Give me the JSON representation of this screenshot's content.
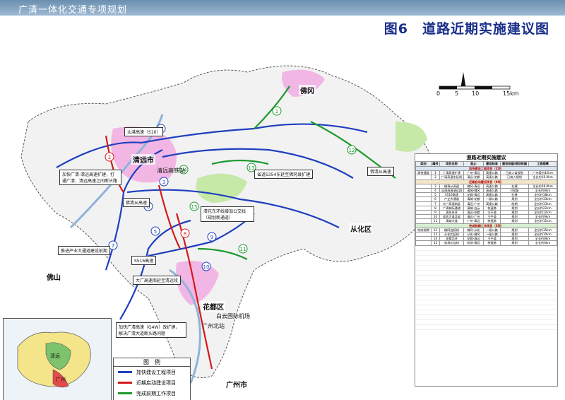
{
  "header": {
    "doc_title": "广清一体化交通专项规划",
    "figure_title": "图6　道路近期实施建议图"
  },
  "scale_bar": {
    "ticks": [
      "0",
      "5",
      "10",
      "15km"
    ],
    "north_letter": "N"
  },
  "places": {
    "qingyuan": "清远市",
    "fogang": "佛冈",
    "conghua": "从化区",
    "foshan": "佛山",
    "huadu": "花都区",
    "guangzhou": "广州市",
    "qingcheng_hub": "清远高铁站",
    "huadu_airport": "白云国际机场",
    "guangzhou_north": "广州北站"
  },
  "road_labels": {
    "shanqing": "汕湛高速（S16）",
    "s516": "S516高速",
    "yinglong": "佛清从高速"
  },
  "callouts": [
    "加快广清-清远高速扩建，打通广清、清远高速之间断头路",
    "省道S354东延至佛冈县扩建",
    "清花东环线增加公交线（规划新通道）",
    "佛清从高速",
    "大广高速南延至清远段",
    "推进产业大通道建设前期",
    "加快广清高速（G4W）改扩建，解决广清大道断头路问题"
  ],
  "route_badges": [
    "1",
    "2",
    "3",
    "4",
    "5",
    "6",
    "7",
    "8",
    "9",
    "10",
    "11",
    "12",
    "13",
    "14",
    "15"
  ],
  "table": {
    "title": "道路近期实施建议",
    "headers": [
      "类别",
      "编号",
      "项目名称",
      "起止",
      "建设标准",
      "建设依据/规划依据",
      "工程规模"
    ],
    "sections": [
      "加快建设工程项目（2项）",
      "近期启动建设项目（9项）",
      "完成前期工作项目（5项）"
    ],
    "rows": [
      [
        "高快速路",
        "1",
        "广清高速扩建",
        "广州-清远",
        "高速公路",
        "已纳入省规划",
        "广州段约42km"
      ],
      [
        "",
        "2",
        "广清高速东延线",
        "清远-花都",
        "高速公路",
        "已纳入规划",
        "全长约16.9km"
      ],
      [
        "",
        "3",
        "佛清从高速",
        "佛冈-清远",
        "高速公路",
        "在建",
        "全长约28.9km"
      ],
      [
        "",
        "4",
        "汕湛高速清远段",
        "清城-佛冈",
        "高速公路",
        "已批复",
        "全长约8km"
      ],
      [
        "",
        "5",
        "S516高速",
        "花都-清远",
        "高速公路",
        "在建",
        "全长约18km"
      ],
      [
        "",
        "6",
        "产业大通道",
        "清城-花都",
        "一级公路",
        "规划",
        "全长约33km"
      ],
      [
        "",
        "7",
        "大广高速南延",
        "清远-广州",
        "高速公路",
        "前期",
        "全长约13km"
      ],
      [
        "",
        "8",
        "广清城际通道",
        "清城-白云",
        "快速路",
        "规划",
        "全长约22km"
      ],
      [
        "",
        "9",
        "清花东环",
        "清远-花都",
        "主干道",
        "规划",
        "全长约12km"
      ],
      [
        "",
        "10",
        "迎宾大道北延",
        "清远-广州",
        "主干道",
        "规划",
        "全长约9km"
      ],
      [
        "",
        "11",
        "清城大道",
        "广州-清远",
        "快速路",
        "规划",
        "全长约11km"
      ],
      [
        "完成前期",
        "12",
        "佛冈连接线",
        "佛冈-从化",
        "一级公路",
        "规划",
        "全长约15km"
      ],
      [
        "",
        "13",
        "从化北延线",
        "从化-佛冈",
        "一级公路",
        "规划",
        "全长约10km"
      ],
      [
        "",
        "14",
        "花都北环",
        "花都-清远",
        "主干道",
        "规划",
        "全长约8km"
      ],
      [
        "",
        "15",
        "机场北连线",
        "机场-清远",
        "快速路",
        "规划",
        "全长约6km"
      ]
    ]
  },
  "legend": {
    "title": "图　例",
    "items": [
      {
        "label": "加快建设工程项目",
        "color": "#1f3fbf"
      },
      {
        "label": "近期启动建设项目",
        "color": "#d41a1a"
      },
      {
        "label": "完成前期工作项目",
        "color": "#1c9a2e"
      }
    ]
  },
  "inset": {
    "labels": [
      "清远",
      "广州"
    ]
  },
  "colors": {
    "fast": "#1f3fbf",
    "start": "#d41a1a",
    "prep": "#1c9a2e",
    "urban": "#f2b6e4",
    "green": "#c6e9a8"
  }
}
